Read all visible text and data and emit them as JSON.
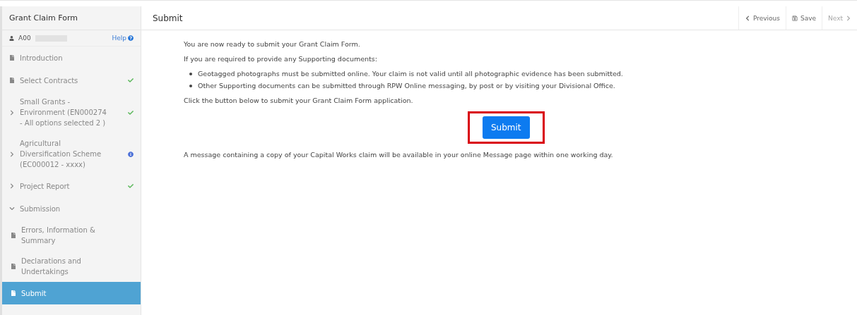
{
  "sidebar": {
    "title": "Grant Claim Form",
    "user": {
      "id": "A00",
      "help": "Help"
    },
    "items": [
      {
        "label": "Introduction",
        "kind": "page",
        "complete": false,
        "info": false,
        "selected": false
      },
      {
        "label": "Select Contracts",
        "kind": "page",
        "complete": true,
        "info": false,
        "selected": false
      },
      {
        "label": "Small Grants - Environment (EN000274 - All options selected 2 )",
        "kind": "section",
        "expanded": false,
        "complete": true,
        "info": false,
        "selected": false
      },
      {
        "label": "Agricultural Diversification Scheme (EC000012 - xxxx)",
        "kind": "section",
        "expanded": false,
        "complete": false,
        "info": true,
        "selected": false
      },
      {
        "label": "Project Report",
        "kind": "section",
        "expanded": false,
        "complete": true,
        "info": false,
        "selected": false
      },
      {
        "label": "Submission",
        "kind": "section",
        "expanded": true,
        "complete": false,
        "info": false,
        "selected": false,
        "children": [
          {
            "label": "Errors, Information & Summary",
            "kind": "page",
            "complete": false,
            "info": false,
            "selected": false
          },
          {
            "label": "Declarations and Undertakings",
            "kind": "page",
            "complete": false,
            "info": false,
            "selected": false
          },
          {
            "label": "Submit",
            "kind": "page",
            "complete": false,
            "info": false,
            "selected": true
          }
        ]
      }
    ]
  },
  "header": {
    "title": "Submit",
    "nav": [
      {
        "label": "Previous",
        "kind": "previous",
        "disabled": false
      },
      {
        "label": "Save",
        "kind": "save",
        "disabled": false
      },
      {
        "label": "Next",
        "kind": "next",
        "disabled": true
      }
    ]
  },
  "content": {
    "intro": "You are now ready to submit your Grant Claim Form.",
    "lead": "If you are required to provide any Supporting documents:",
    "bullets": [
      "Geotagged photographs must be submitted online. Your claim is not valid until all photographic evidence has been submitted.",
      "Other Supporting documents can be submitted through RPW Online messaging, by post or by visiting your Divisional Office."
    ],
    "instruction": "Click the button below to submit your Grant Claim Form application.",
    "submit": {
      "label": "Submit",
      "highlighted": true
    },
    "footer": "A message containing a copy of your Capital Works claim will be available in your online Message page within one working day."
  }
}
